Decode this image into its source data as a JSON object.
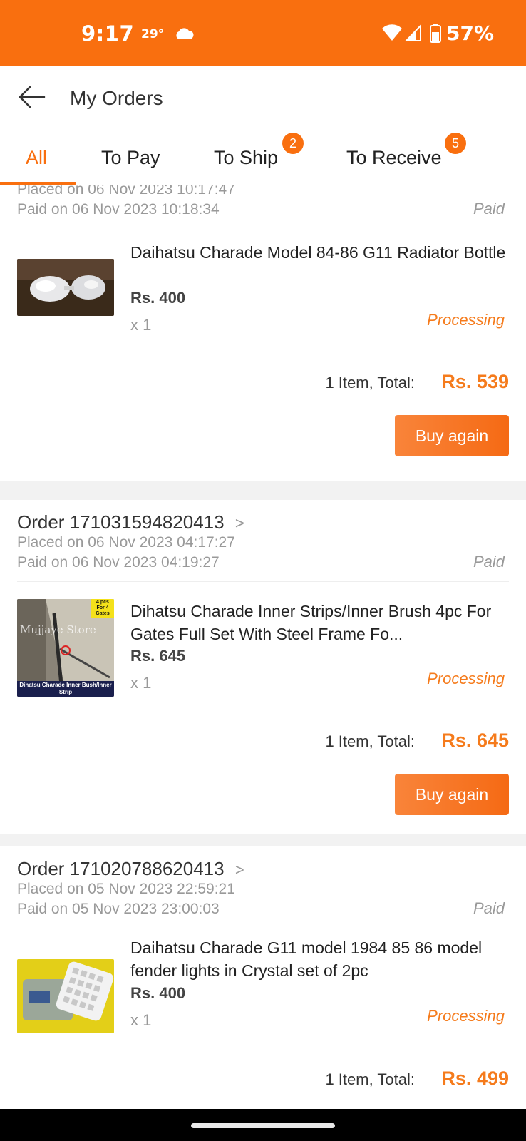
{
  "status_bar": {
    "time": "9:17",
    "temperature": "29°",
    "battery": "57%",
    "background": "#f96f0f"
  },
  "header": {
    "title": "My Orders"
  },
  "tabs": [
    {
      "label": "All",
      "active": true,
      "badge": null
    },
    {
      "label": "To Pay",
      "active": false,
      "badge": null
    },
    {
      "label": "To Ship",
      "active": false,
      "badge": "2"
    },
    {
      "label": "To Receive",
      "active": false,
      "badge": "5"
    }
  ],
  "orders": [
    {
      "order_prefix": "",
      "order_number": "",
      "placed": "Placed on 06 Nov 2023  10:17:47",
      "paid_on": "Paid on 06 Nov 2023  10:18:34",
      "payment_status": "Paid",
      "product_name": "Daihatsu Charade Model 84-86 G11 Radiator Bottle",
      "price": "Rs. 400",
      "quantity": "x 1",
      "status": "Processing",
      "total_label": "1 Item, Total:",
      "total": "Rs. 539",
      "action": "Buy again"
    },
    {
      "order_prefix": "Order",
      "order_number": "171031594820413",
      "placed": "Placed on 06 Nov 2023  04:17:27",
      "paid_on": "Paid on 06 Nov 2023  04:19:27",
      "payment_status": "Paid",
      "product_name": "Dihatsu Charade Inner Strips/Inner Brush 4pc For Gates Full Set With Steel Frame Fo...",
      "price": "Rs. 645",
      "quantity": "x 1",
      "status": "Processing",
      "total_label": "1 Item, Total:",
      "total": "Rs. 645",
      "action": "Buy again",
      "image_text": {
        "store": "Mujjaye Store",
        "corner": "4 pcs For 4 Gates",
        "caption": "Dihatsu Charade Inner Bush/Inner Strip"
      }
    },
    {
      "order_prefix": "Order",
      "order_number": "171020788620413",
      "placed": "Placed on 05 Nov 2023  22:59:21",
      "paid_on": "Paid on 05 Nov 2023  23:00:03",
      "payment_status": "Paid",
      "product_name": "Daihatsu Charade G11 model 1984 85 86 model fender lights in Crystal set of 2pc",
      "price": "Rs. 400",
      "quantity": "x 1",
      "status": "Processing",
      "total_label": "1 Item, Total:",
      "total": "Rs. 499"
    }
  ],
  "colors": {
    "accent": "#f96f0f",
    "status_text": "#f57b1c",
    "muted_text": "#999999"
  }
}
